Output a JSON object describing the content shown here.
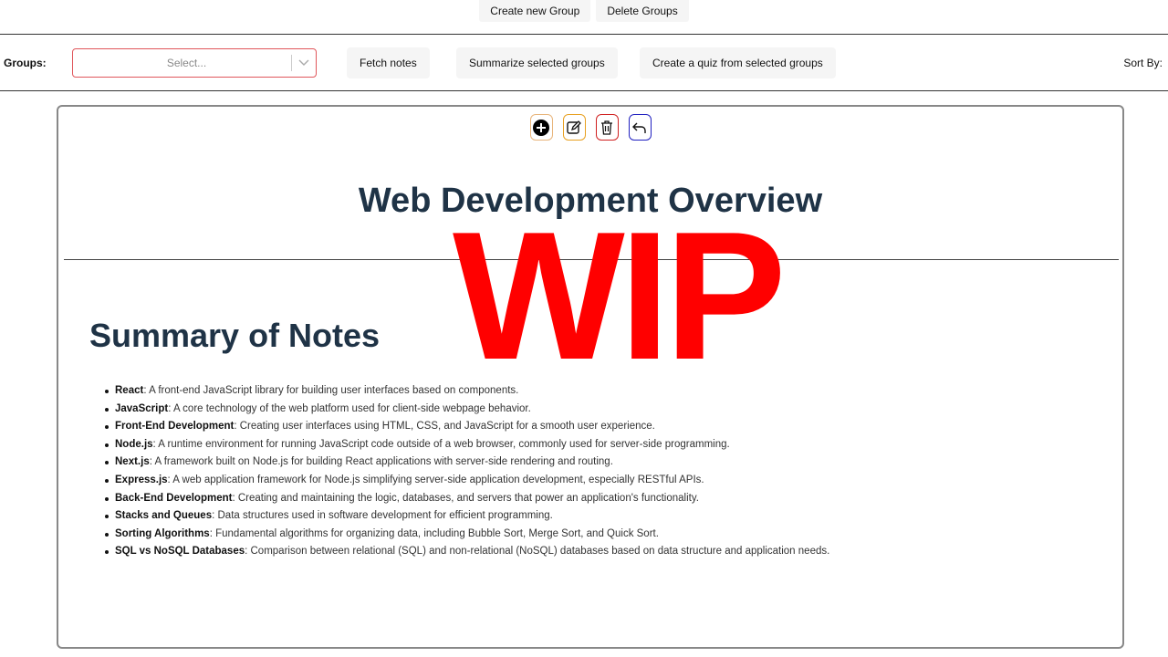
{
  "top_buttons": {
    "create_group": "Create new Group",
    "delete_groups": "Delete Groups"
  },
  "toolbar": {
    "groups_label": "Groups:",
    "select_placeholder": "Select...",
    "fetch_notes": "Fetch notes",
    "summarize": "Summarize selected groups",
    "quiz": "Create a quiz from selected groups",
    "sort_by": "Sort By:"
  },
  "icons": [
    "add-icon",
    "edit-icon",
    "trash-icon",
    "undo-icon"
  ],
  "note": {
    "title": "Web Development Overview",
    "watermark": "WIP",
    "subtitle": "Summary of Notes",
    "items": [
      {
        "term": "React",
        "desc": ": A front-end JavaScript library for building user interfaces based on components."
      },
      {
        "term": "JavaScript",
        "desc": ": A core technology of the web platform used for client-side webpage behavior."
      },
      {
        "term": "Front-End Development",
        "desc": ": Creating user interfaces using HTML, CSS, and JavaScript for a smooth user experience."
      },
      {
        "term": "Node.js",
        "desc": ": A runtime environment for running JavaScript code outside of a web browser, commonly used for server-side programming."
      },
      {
        "term": "Next.js",
        "desc": ": A framework built on Node.js for building React applications with server-side rendering and routing."
      },
      {
        "term": "Express.js",
        "desc": ": A web application framework for Node.js simplifying server-side application development, especially RESTful APIs."
      },
      {
        "term": "Back-End Development",
        "desc": ": Creating and maintaining the logic, databases, and servers that power an application's functionality."
      },
      {
        "term": "Stacks and Queues",
        "desc": ": Data structures used in software development for efficient programming."
      },
      {
        "term": "Sorting Algorithms",
        "desc": ": Fundamental algorithms for organizing data, including Bubble Sort, Merge Sort, and Quick Sort."
      },
      {
        "term": "SQL vs NoSQL Databases",
        "desc": ": Comparison between relational (SQL) and non-relational (NoSQL) databases based on data structure and application needs."
      }
    ]
  }
}
